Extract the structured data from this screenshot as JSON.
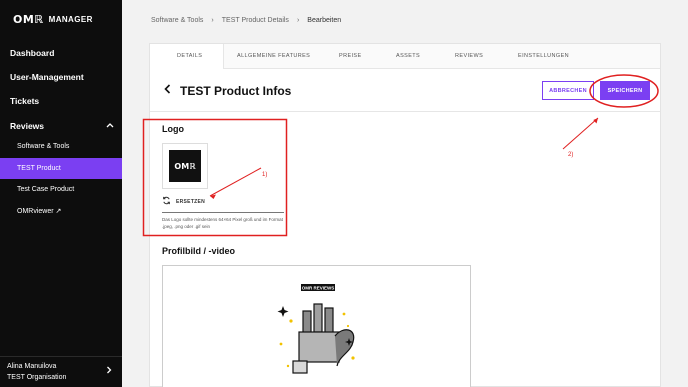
{
  "sidebar": {
    "logo_mark": "OMℝ",
    "logo_text": "MANAGER",
    "items": [
      {
        "label": "Dashboard"
      },
      {
        "label": "User-Management"
      },
      {
        "label": "Tickets"
      },
      {
        "label": "Reviews"
      }
    ],
    "sub_items": [
      {
        "label": "Software & Tools"
      },
      {
        "label": "TEST Product"
      },
      {
        "label": "Test Case Product"
      },
      {
        "label": "OMRviewer ↗"
      }
    ],
    "active_sub_index": 1,
    "user_name": "Alina Manuilova",
    "user_org": "TEST Organisation"
  },
  "breadcrumb": [
    "Software & Tools",
    "TEST Product Details",
    "Bearbeiten"
  ],
  "tabs": [
    "DETAILS",
    "ALLGEMEINE FEATURES",
    "PREISE",
    "ASSETS",
    "REVIEWS",
    "EINSTELLUNGEN"
  ],
  "active_tab": "DETAILS",
  "header": {
    "title": "TEST Product Infos",
    "cancel_label": "ABBRECHEN",
    "save_label": "SPEICHERN"
  },
  "logo_section": {
    "title": "Logo",
    "logo_mark": "OMℝ",
    "replace_label": "ERSETZEN",
    "hint": "Das Logo sollte mindestens 64×64 Pixel groß und im Format .jpeg, .png oder .gif sein"
  },
  "media_section": {
    "title": "Profilbild / -video",
    "badge": "OMR REVIEWS"
  },
  "annotations": {
    "label_1": "1)",
    "label_2": "2)",
    "color": "#e02020"
  },
  "colors": {
    "accent": "#7b3ff2",
    "sidebar_bg": "#0d0d0d"
  }
}
